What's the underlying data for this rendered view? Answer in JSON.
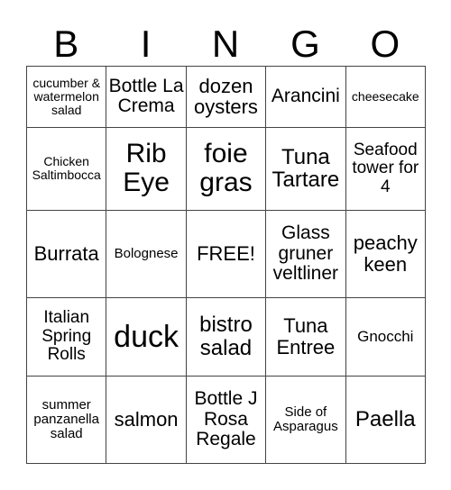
{
  "header": [
    "B",
    "I",
    "N",
    "G",
    "O"
  ],
  "rows": [
    [
      "cucumber & watermelon salad",
      "Bottle La Crema",
      "dozen oysters",
      "Arancini",
      "cheesecake"
    ],
    [
      "Chicken Saltimbocca",
      "Rib Eye",
      "foie gras",
      "Tuna Tartare",
      "Seafood tower for 4"
    ],
    [
      "Burrata",
      "Bolognese",
      "FREE!",
      "Glass gruner veltliner",
      "peachy keen"
    ],
    [
      "Italian Spring Rolls",
      "duck",
      "bistro salad",
      "Tuna Entree",
      "Gnocchi"
    ],
    [
      "summer panzanella salad",
      "salmon",
      "Bottle J Rosa Regale",
      "Side of Asparagus",
      "Paella"
    ]
  ]
}
